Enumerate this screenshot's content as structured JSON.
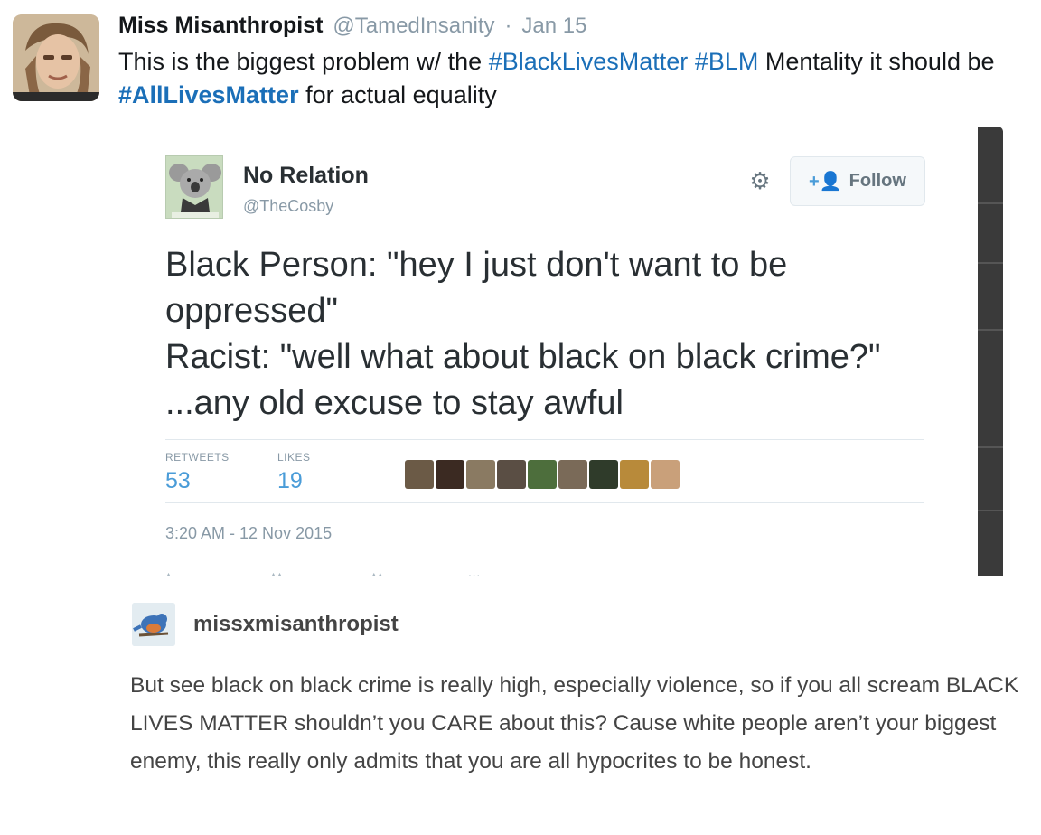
{
  "outer_tweet": {
    "author_name": "Miss Misanthropist",
    "author_handle": "@TamedInsanity",
    "separator": "·",
    "date": "Jan 15",
    "text_before": "This is the biggest problem w/ the ",
    "hashtag_1": "#BlackLivesMatter",
    "text_space": " ",
    "hashtag_2": "#BLM",
    "text_middle": " Mentality it should be ",
    "hashtag_3": "#AllLivesMatter",
    "text_after": " for actual equality",
    "hashtag_color": "#1b6fb8"
  },
  "embedded_tweet": {
    "author_name": "No Relation",
    "author_handle": "@TheCosby",
    "follow_label": "Follow",
    "icons": [
      "gear-icon",
      "follow-person-icon"
    ],
    "text_line_1": "Black Person: \"hey I just don't want to be oppressed\"",
    "text_line_2": "Racist: \"well what about black on black crime?\" ...any old excuse to stay awful",
    "stats": {
      "retweets_label": "RETWEETS",
      "retweets_value": "53",
      "likes_label": "LIKES",
      "likes_value": "19"
    },
    "liker_colors": [
      "#6b5a46",
      "#3b2a22",
      "#8a7a62",
      "#5a4e44",
      "#4d6e3c",
      "#7a6a58",
      "#2f3b2a",
      "#b88a3a",
      "#c9a07a"
    ],
    "timestamp": "3:20 AM - 12 Nov 2015",
    "accent": "#4a9cd8"
  },
  "tumblr_post": {
    "username": "missxmisanthropist",
    "text": "But see black on black crime is really high, especially violence, so if you all scream BLACK LIVES MATTER shouldn’t you CARE about this? Cause white people aren’t your biggest enemy, this really only admits that you are all hypocrites to be honest."
  }
}
